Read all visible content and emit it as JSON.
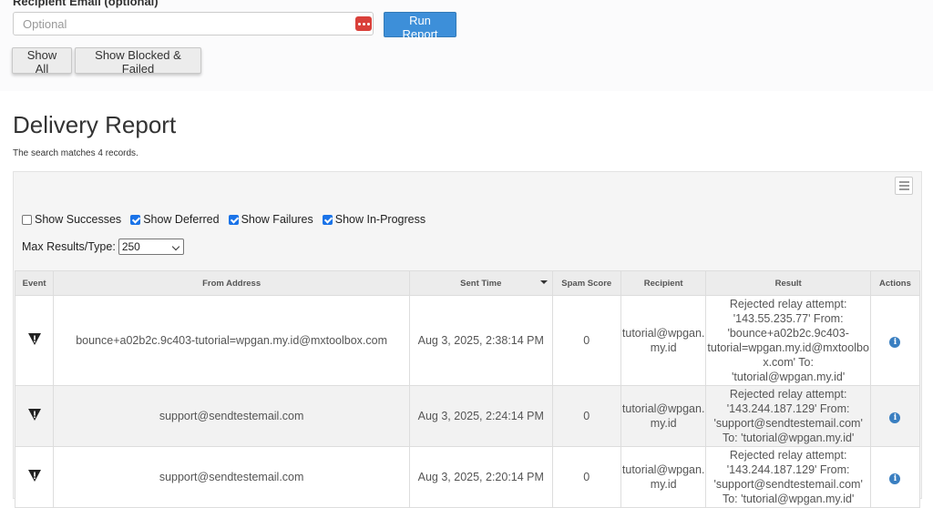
{
  "form": {
    "recipient_label": "Recipient Email (optional)",
    "recipient_placeholder": "Optional",
    "run_label": "Run Report",
    "show_all_label": "Show All",
    "show_blocked_label": "Show Blocked & Failed"
  },
  "report": {
    "title": "Delivery Report",
    "matches": "The search matches 4 records."
  },
  "filters": [
    {
      "label": "Show Successes",
      "checked": false
    },
    {
      "label": "Show Deferred",
      "checked": true
    },
    {
      "label": "Show Failures",
      "checked": true
    },
    {
      "label": "Show In-Progress",
      "checked": true
    }
  ],
  "max_results": {
    "label": "Max Results/Type:",
    "value": "250"
  },
  "table": {
    "headers": [
      "Event",
      "From Address",
      "Sent Time",
      "Spam Score",
      "Recipient",
      "Result",
      "Actions"
    ],
    "rows": [
      {
        "event_icon": "warning-icon",
        "from": "bounce+a02b2c.9c403-tutorial=wpgan.my.id@mxtoolbox.com",
        "sent": "Aug 3, 2025, 2:38:14 PM",
        "spam": "0",
        "recipient_l1": "tutorial@wpgan.",
        "recipient_l2": "my.id",
        "result": [
          "Rejected relay attempt:",
          "'143.55.235.77' From:",
          "'bounce+a02b2c.9c403-",
          "tutorial=wpgan.my.id@mxtoolbo",
          "x.com' To:",
          "'tutorial@wpgan.my.id'"
        ],
        "action_icon": "info-icon"
      },
      {
        "event_icon": "warning-icon",
        "from": "support@sendtestemail.com",
        "sent": "Aug 3, 2025, 2:24:14 PM",
        "spam": "0",
        "recipient_l1": "tutorial@wpgan.",
        "recipient_l2": "my.id",
        "result": [
          "Rejected relay attempt:",
          "'143.244.187.129' From:",
          "'support@sendtestemail.com'",
          "To: 'tutorial@wpgan.my.id'"
        ],
        "action_icon": "info-icon"
      },
      {
        "event_icon": "warning-icon",
        "from": "support@sendtestemail.com",
        "sent": "Aug 3, 2025, 2:20:14 PM",
        "spam": "0",
        "recipient_l1": "tutorial@wpgan.",
        "recipient_l2": "my.id",
        "result": [
          "Rejected relay attempt:",
          "'143.244.187.129' From:",
          "'support@sendtestemail.com'",
          "To: 'tutorial@wpgan.my.id'"
        ],
        "action_icon": "info-icon"
      }
    ]
  }
}
